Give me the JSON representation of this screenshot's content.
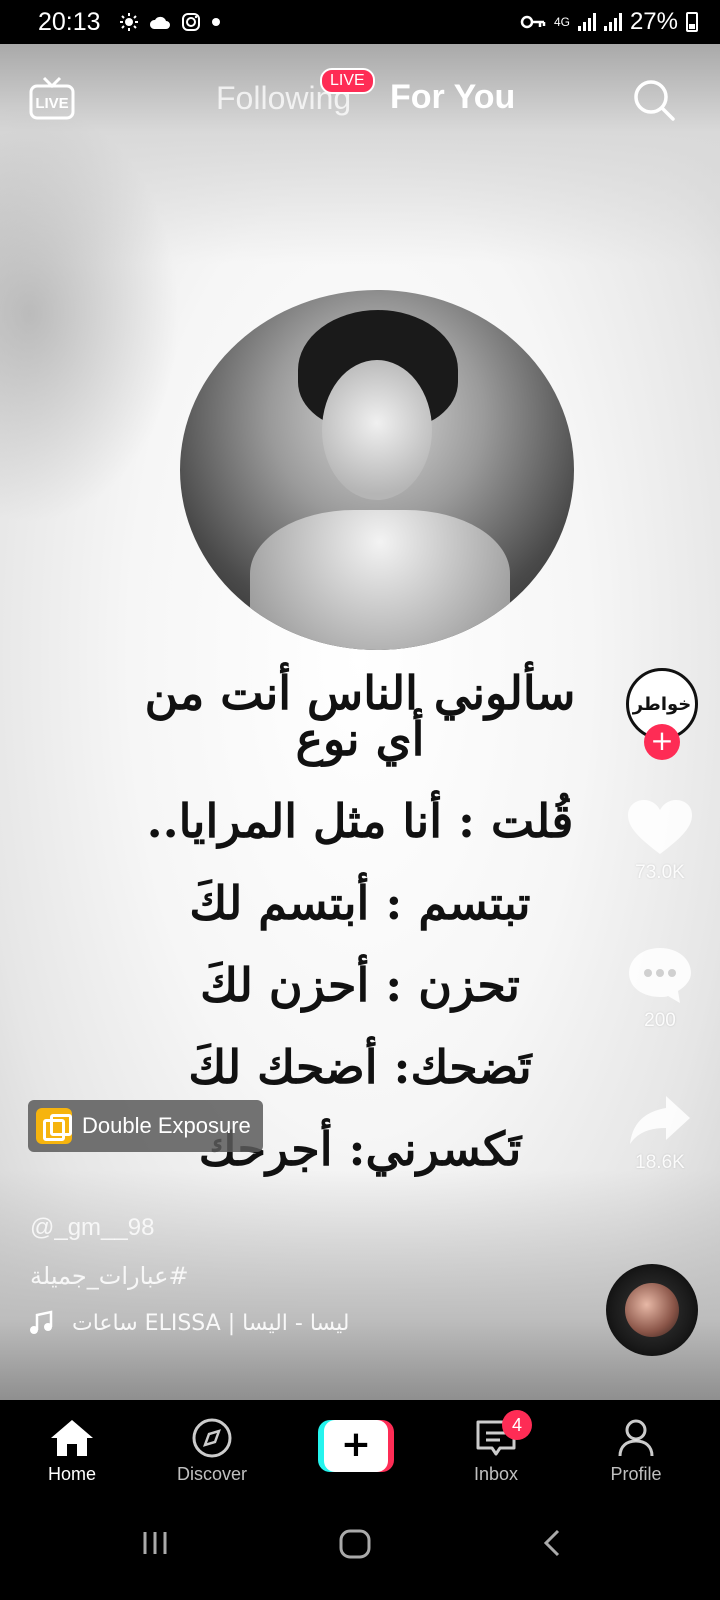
{
  "status_bar": {
    "time": "20:13",
    "network": "4G",
    "battery": "27%"
  },
  "top_nav": {
    "live_label": "LIVE",
    "following_label": "Following",
    "live_badge": "LIVE",
    "for_you_label": "For You"
  },
  "video": {
    "poem_lines": [
      "سألوني الناس أنت من أي نوع",
      "قُلت : أنا مثل المرايا..",
      "تبتسم : أبتسم لكَ",
      "تحزن : أحزن لكَ",
      "تَضحك: أضحك لكَ",
      "تَكسرني: أجرحك"
    ],
    "creator_avatar_text": "خواطر",
    "likes": "73.0K",
    "comments": "200",
    "shares": "18.6K",
    "effect_label": "Double Exposure",
    "username": "@_gm__98",
    "hashtag": "#عبارات_جميلة",
    "music_text": "ساعات ELISSA | ليسا - اليسا"
  },
  "bottom_nav": {
    "items": [
      {
        "label": "Home"
      },
      {
        "label": "Discover"
      },
      {
        "label": "Inbox"
      },
      {
        "label": "Profile"
      }
    ],
    "inbox_badge": "4"
  },
  "colors": {
    "accent": "#fe2c55",
    "cyan": "#25f4ee"
  }
}
